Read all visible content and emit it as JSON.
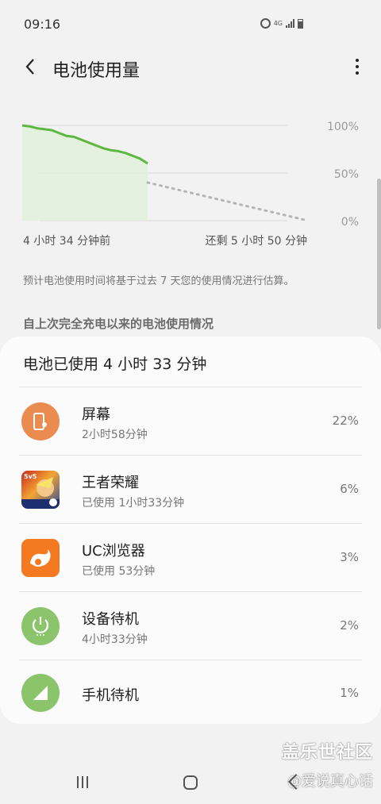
{
  "status_bar": {
    "time": "09:16",
    "network": "4G"
  },
  "app_bar": {
    "title": "电池使用量"
  },
  "chart_data": {
    "type": "line",
    "y_ticks": [
      "100%",
      "50%",
      "0%"
    ],
    "ylim": [
      0,
      100
    ],
    "series": [
      {
        "values": [
          100,
          99,
          97,
          96,
          95,
          92,
          89,
          88,
          85,
          82,
          79,
          76,
          74,
          73,
          71,
          68,
          65,
          60
        ],
        "style": "solid",
        "color": "#5cb840"
      },
      {
        "values": [
          40,
          0
        ],
        "style": "dotted",
        "color": "#b5b5b5"
      }
    ],
    "x_labels": {
      "start": "4 小时 34 分钟前",
      "end": "还剩 5 小时 50 分钟"
    }
  },
  "estimate_note": "预计电池使用时间将基于过去 7 天您的使用情况进行估算。",
  "section_header": "自上次完全充电以来的电池使用情况",
  "card": {
    "title": "电池已使用 4 小时 33 分钟",
    "items": [
      {
        "name": "屏幕",
        "sub": "2小时58分钟",
        "percent": "22%",
        "icon": "screen-icon"
      },
      {
        "name": "王者荣耀",
        "sub": "已使用 1小时33分钟",
        "percent": "6%",
        "icon": "game-app-icon",
        "badge": "5v5"
      },
      {
        "name": "UC浏览器",
        "sub": "已使用 53分钟",
        "percent": "3%",
        "icon": "uc-browser-icon"
      },
      {
        "name": "设备待机",
        "sub": "4小时33分钟",
        "percent": "2%",
        "icon": "power-icon"
      },
      {
        "name": "手机待机",
        "sub": "",
        "percent": "1%",
        "icon": "signal-icon"
      }
    ]
  },
  "watermark": {
    "line1": "盖乐世社区",
    "line2": "@爱说真心话"
  },
  "colors": {
    "chart_line": "#5cb840",
    "chart_fill": "#dff0d8",
    "screen_icon": "#ea8c50",
    "standby_icon": "#8bc46a",
    "uc_icon": "#f47a22"
  }
}
